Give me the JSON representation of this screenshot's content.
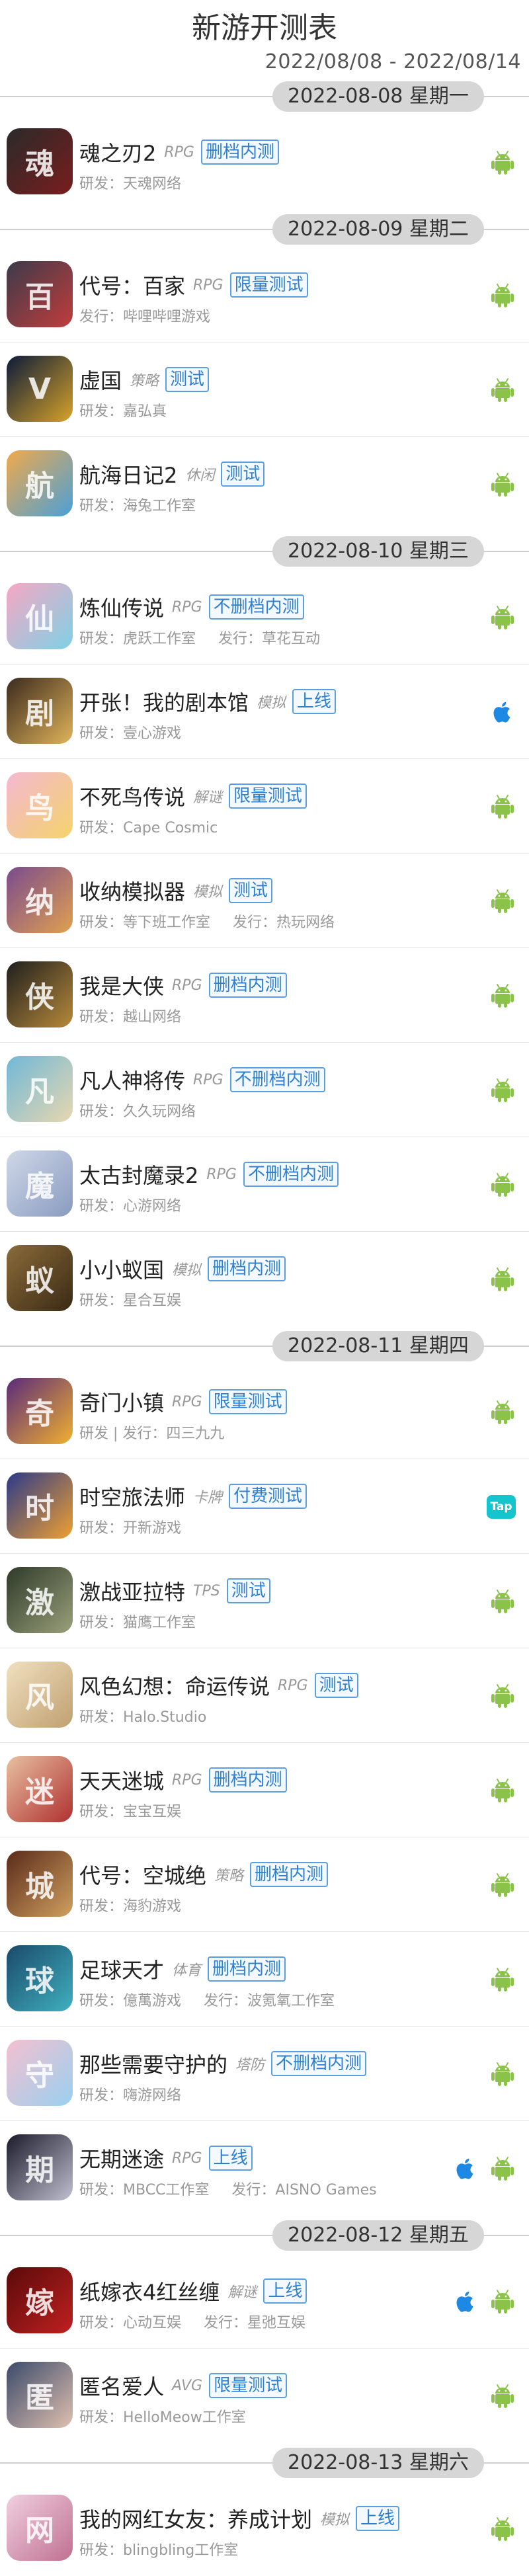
{
  "header": {
    "title": "新游开测表",
    "date_range": "2022/08/08 - 2022/08/14"
  },
  "colors": {
    "badge_blue": "#2d7fd2",
    "android_green": "#8bc34a",
    "ios_blue": "#1e88e5",
    "taptap_cyan": "#15c5ce",
    "date_pill_gray": "#d6d6d6"
  },
  "days": [
    {
      "date": "2022-08-08 星期一",
      "games": [
        {
          "name": "魂之刃2",
          "genre": "RPG",
          "test": "删档内测",
          "dev": "研发：天魂网络",
          "pub": "",
          "platforms": [
            "android-icon"
          ],
          "icon_colors": [
            "#2a2a2a",
            "#7a1d1d"
          ],
          "glyph": "魂"
        }
      ]
    },
    {
      "date": "2022-08-09 星期二",
      "games": [
        {
          "name": "代号：百家",
          "genre": "RPG",
          "test": "限量测试",
          "dev": "发行：哔哩哔哩游戏",
          "pub": "",
          "platforms": [
            "android-icon"
          ],
          "icon_colors": [
            "#3b3b4a",
            "#c23c3c"
          ],
          "glyph": "百"
        },
        {
          "name": "虚国",
          "genre": "策略",
          "test": "测试",
          "dev": "研发：嘉弘真",
          "pub": "",
          "platforms": [
            "android-icon"
          ],
          "icon_colors": [
            "#0b1a3a",
            "#d8a32a"
          ],
          "glyph": "V"
        },
        {
          "name": "航海日记2",
          "genre": "休闲",
          "test": "测试",
          "dev": "研发：海兔工作室",
          "pub": "",
          "platforms": [
            "android-icon"
          ],
          "icon_colors": [
            "#f2a94a",
            "#4aa0d8"
          ],
          "glyph": "航"
        }
      ]
    },
    {
      "date": "2022-08-10 星期三",
      "games": [
        {
          "name": "炼仙传说",
          "genre": "RPG",
          "test": "不删档内测",
          "dev": "研发：虎跃工作室",
          "pub": "发行：草花互动",
          "platforms": [
            "android-icon"
          ],
          "icon_colors": [
            "#f7a7c3",
            "#7fd1e6"
          ],
          "glyph": "仙"
        },
        {
          "name": "开张！我的剧本馆",
          "genre": "模拟",
          "test": "上线",
          "dev": "研发：壹心游戏",
          "pub": "",
          "platforms": [
            "apple-icon"
          ],
          "icon_colors": [
            "#3b2a1e",
            "#e0b45a"
          ],
          "glyph": "剧"
        },
        {
          "name": "不死鸟传说",
          "genre": "解谜",
          "test": "限量测试",
          "dev": "研发：Cape Cosmic",
          "pub": "",
          "platforms": [
            "android-icon"
          ],
          "icon_colors": [
            "#f4b8d2",
            "#f5d36b"
          ],
          "glyph": "鸟"
        },
        {
          "name": "收纳模拟器",
          "genre": "模拟",
          "test": "测试",
          "dev": "研发：等下班工作室",
          "pub": "发行：热玩网络",
          "platforms": [
            "android-icon"
          ],
          "icon_colors": [
            "#7a4b8e",
            "#e0a050"
          ],
          "glyph": "纳"
        },
        {
          "name": "我是大侠",
          "genre": "RPG",
          "test": "删档内测",
          "dev": "研发：越山网络",
          "pub": "",
          "platforms": [
            "android-icon"
          ],
          "icon_colors": [
            "#1e1e1e",
            "#b88a3a"
          ],
          "glyph": "侠"
        },
        {
          "name": "凡人神将传",
          "genre": "RPG",
          "test": "不删档内测",
          "dev": "研发：久久玩网络",
          "pub": "",
          "platforms": [
            "android-icon"
          ],
          "icon_colors": [
            "#6fb8d8",
            "#e8d7b0"
          ],
          "glyph": "凡"
        },
        {
          "name": "太古封魔录2",
          "genre": "RPG",
          "test": "不删档内测",
          "dev": "研发：心游网络",
          "pub": "",
          "platforms": [
            "android-icon"
          ],
          "icon_colors": [
            "#cfd8e8",
            "#8a9bc0"
          ],
          "glyph": "魔"
        },
        {
          "name": "小小蚁国",
          "genre": "模拟",
          "test": "删档内测",
          "dev": "研发：星合互娱",
          "pub": "",
          "platforms": [
            "android-icon"
          ],
          "icon_colors": [
            "#8a6b3a",
            "#3a2a14"
          ],
          "glyph": "蚁"
        }
      ]
    },
    {
      "date": "2022-08-11 星期四",
      "games": [
        {
          "name": "奇门小镇",
          "genre": "RPG",
          "test": "限量测试",
          "dev": "研发 | 发行：四三九九",
          "pub": "",
          "platforms": [
            "android-icon"
          ],
          "icon_colors": [
            "#5a2a7a",
            "#f0b030"
          ],
          "glyph": "奇"
        },
        {
          "name": "时空旅法师",
          "genre": "卡牌",
          "test": "付费测试",
          "dev": "研发：开新游戏",
          "pub": "",
          "platforms": [
            "taptap-icon"
          ],
          "icon_colors": [
            "#2a3a8a",
            "#f0a030"
          ],
          "glyph": "时"
        },
        {
          "name": "激战亚拉特",
          "genre": "TPS",
          "test": "测试",
          "dev": "研发：猫鹰工作室",
          "pub": "",
          "platforms": [
            "android-icon"
          ],
          "icon_colors": [
            "#2e3a2a",
            "#9aa07a"
          ],
          "glyph": "激"
        },
        {
          "name": "风色幻想：命运传说",
          "genre": "RPG",
          "test": "测试",
          "dev": "研发：Halo.Studio",
          "pub": "",
          "platforms": [
            "android-icon"
          ],
          "icon_colors": [
            "#f0e0c0",
            "#c0a070"
          ],
          "glyph": "风"
        },
        {
          "name": "天天迷城",
          "genre": "RPG",
          "test": "删档内测",
          "dev": "研发：宝宝互娱",
          "pub": "",
          "platforms": [
            "android-icon"
          ],
          "icon_colors": [
            "#e8c0a0",
            "#b03030"
          ],
          "glyph": "迷"
        },
        {
          "name": "代号：空城绝",
          "genre": "策略",
          "test": "删档内测",
          "dev": "研发：海豹游戏",
          "pub": "",
          "platforms": [
            "android-icon"
          ],
          "icon_colors": [
            "#5a2a1a",
            "#d0a060"
          ],
          "glyph": "城"
        },
        {
          "name": "足球天才",
          "genre": "体育",
          "test": "删档内测",
          "dev": "研发：億萬游戏",
          "pub": "发行：波氪氧工作室",
          "platforms": [
            "android-icon"
          ],
          "icon_colors": [
            "#1a4a6a",
            "#40b0c0"
          ],
          "glyph": "球"
        },
        {
          "name": "那些需要守护的",
          "genre": "塔防",
          "test": "不删档内测",
          "dev": "研发：嗨游网络",
          "pub": "",
          "platforms": [
            "android-icon"
          ],
          "icon_colors": [
            "#f4c0d0",
            "#9ad0f0"
          ],
          "glyph": "守"
        },
        {
          "name": "无期迷途",
          "genre": "RPG",
          "test": "上线",
          "dev": "研发：MBCC工作室",
          "pub": "发行：AISNO Games",
          "platforms": [
            "apple-icon",
            "android-icon"
          ],
          "icon_colors": [
            "#1a1a2a",
            "#c0c0d0"
          ],
          "glyph": "期"
        }
      ]
    },
    {
      "date": "2022-08-12 星期五",
      "games": [
        {
          "name": "纸嫁衣4红丝缠",
          "genre": "解谜",
          "test": "上线",
          "dev": "研发：心动互娱",
          "pub": "发行：星弛互娱",
          "platforms": [
            "apple-icon",
            "android-icon"
          ],
          "icon_colors": [
            "#5a0a0a",
            "#c02020"
          ],
          "glyph": "嫁"
        },
        {
          "name": "匿名爱人",
          "genre": "AVG",
          "test": "限量测试",
          "dev": "研发：HelloMeow工作室",
          "pub": "",
          "platforms": [
            "android-icon"
          ],
          "icon_colors": [
            "#3a4a6a",
            "#e0c0b0"
          ],
          "glyph": "匿"
        }
      ]
    },
    {
      "date": "2022-08-13 星期六",
      "games": [
        {
          "name": "我的网红女友：养成计划",
          "genre": "模拟",
          "test": "上线",
          "dev": "研发：blingbling工作室",
          "pub": "",
          "platforms": [
            "android-icon"
          ],
          "icon_colors": [
            "#f0d0e0",
            "#c07090"
          ],
          "glyph": "网"
        }
      ]
    }
  ]
}
